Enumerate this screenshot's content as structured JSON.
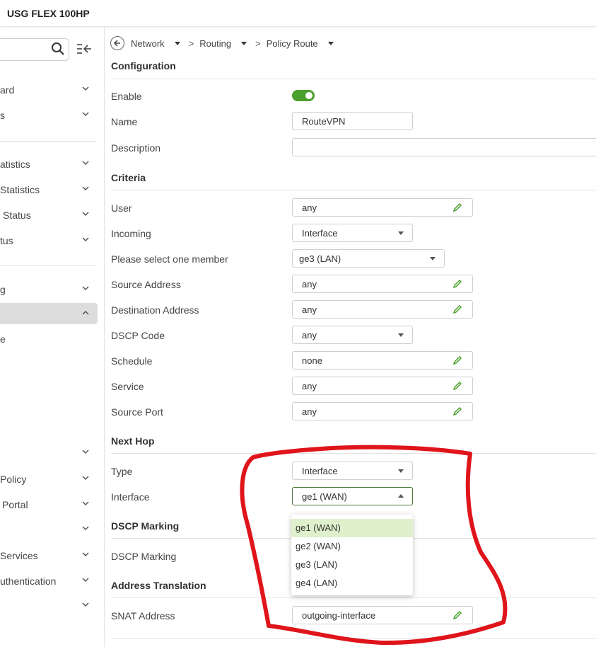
{
  "app": {
    "title": "USG FLEX 100HP"
  },
  "sidebar": {
    "items": [
      {
        "label": "ard"
      },
      {
        "label": "s"
      },
      {
        "label": "atistics"
      },
      {
        "label": "Statistics"
      },
      {
        "label": "Status"
      },
      {
        "label": "tus"
      },
      {
        "label": "g"
      },
      {
        "label": ""
      },
      {
        "label": "e"
      },
      {
        "label": ""
      },
      {
        "label": "Policy"
      },
      {
        "label": "Portal"
      },
      {
        "label": ""
      },
      {
        "label": "Services"
      },
      {
        "label": "uthentication"
      },
      {
        "label": ""
      }
    ]
  },
  "breadcrumb": {
    "items": [
      "Network",
      "Routing",
      "Policy Route"
    ],
    "separator": ">"
  },
  "config": {
    "section": "Configuration",
    "enable_label": "Enable",
    "enable_value": true,
    "name_label": "Name",
    "name_value": "RouteVPN",
    "description_label": "Description",
    "description_value": ""
  },
  "criteria": {
    "section": "Criteria",
    "user_label": "User",
    "user_value": "any",
    "incoming_label": "Incoming",
    "incoming_value": "Interface",
    "member_label": "Please select one member",
    "member_value": "ge3 (LAN)",
    "source_address_label": "Source Address",
    "source_address_value": "any",
    "destination_address_label": "Destination Address",
    "destination_address_value": "any",
    "dscp_code_label": "DSCP Code",
    "dscp_code_value": "any",
    "schedule_label": "Schedule",
    "schedule_value": "none",
    "service_label": "Service",
    "service_value": "any",
    "source_port_label": "Source Port",
    "source_port_value": "any"
  },
  "next_hop": {
    "section": "Next Hop",
    "type_label": "Type",
    "type_value": "Interface",
    "interface_label": "Interface",
    "interface_value": "ge1 (WAN)",
    "options": [
      "ge1 (WAN)",
      "ge2 (WAN)",
      "ge3 (LAN)",
      "ge4 (LAN)"
    ],
    "selected_option": "ge1 (WAN)"
  },
  "dscp_marking": {
    "section": "DSCP Marking",
    "label": "DSCP Marking"
  },
  "address_translation": {
    "section": "Address Translation",
    "snat_label": "SNAT Address",
    "snat_value": "outgoing-interface"
  },
  "colors": {
    "accent_green": "#4aa02c",
    "selected_option_bg": "#dff0cc",
    "annotation_red": "#e0141b"
  }
}
